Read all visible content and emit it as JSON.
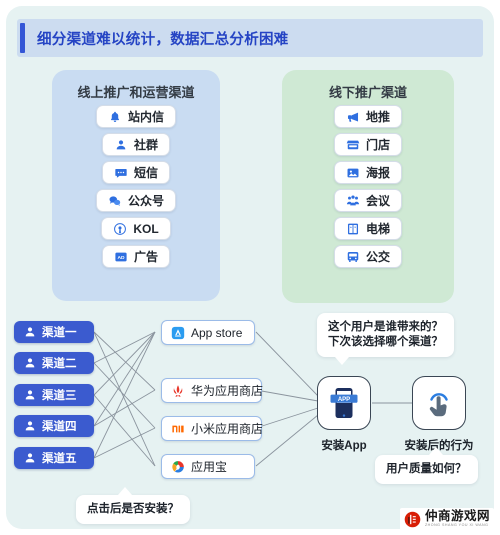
{
  "banner": {
    "title": "细分渠道难以统计，数据汇总分析困难",
    "accent_color": "#3456d6",
    "background_color": "#ccdcf0"
  },
  "panels": {
    "online": {
      "title": "线上推广和运营渠道",
      "background_color": "#c9dcf2",
      "items": [
        {
          "label": "站内信",
          "icon": "bell-icon"
        },
        {
          "label": "社群",
          "icon": "person-icon"
        },
        {
          "label": "短信",
          "icon": "message-icon"
        },
        {
          "label": "公众号",
          "icon": "wechat-icon"
        },
        {
          "label": "KOL",
          "icon": "broadcast-icon"
        },
        {
          "label": "广告",
          "icon": "ad-icon"
        }
      ]
    },
    "offline": {
      "title": "线下推广渠道",
      "background_color": "#cfe9d4",
      "items": [
        {
          "label": "地推",
          "icon": "megaphone-icon"
        },
        {
          "label": "门店",
          "icon": "store-icon"
        },
        {
          "label": "海报",
          "icon": "poster-icon"
        },
        {
          "label": "会议",
          "icon": "conference-icon"
        },
        {
          "label": "电梯",
          "icon": "elevator-icon"
        },
        {
          "label": "公交",
          "icon": "bus-icon"
        }
      ]
    }
  },
  "flow": {
    "channels": [
      {
        "label": "渠道一",
        "icon": "person-icon"
      },
      {
        "label": "渠道二",
        "icon": "person-icon"
      },
      {
        "label": "渠道三",
        "icon": "person-icon"
      },
      {
        "label": "渠道四",
        "icon": "person-icon"
      },
      {
        "label": "渠道五",
        "icon": "person-icon"
      }
    ],
    "channel_color": "#3b5bcf",
    "stores": [
      {
        "label": "App store",
        "icon": "appstore-icon"
      },
      {
        "label": "华为应用商店",
        "icon": "huawei-icon"
      },
      {
        "label": "小米应用商店",
        "icon": "xiaomi-icon"
      },
      {
        "label": "应用宝",
        "icon": "yingyongbao-icon"
      }
    ],
    "stages": [
      {
        "label": "安装App",
        "icon": "phone-app-icon"
      },
      {
        "label": "安装后的行为",
        "icon": "tap-hand-icon"
      }
    ],
    "bubbles": {
      "install_question": "点击后是否安装？",
      "attribution_line1": "这个用户是谁带来的？",
      "attribution_line2": "下次该选择哪个渠道？",
      "quality_question": "用户质量如何？"
    }
  },
  "watermark": {
    "name": "仲商游戏网",
    "sub": "ZHONG SHANG YOU XI WANG"
  }
}
